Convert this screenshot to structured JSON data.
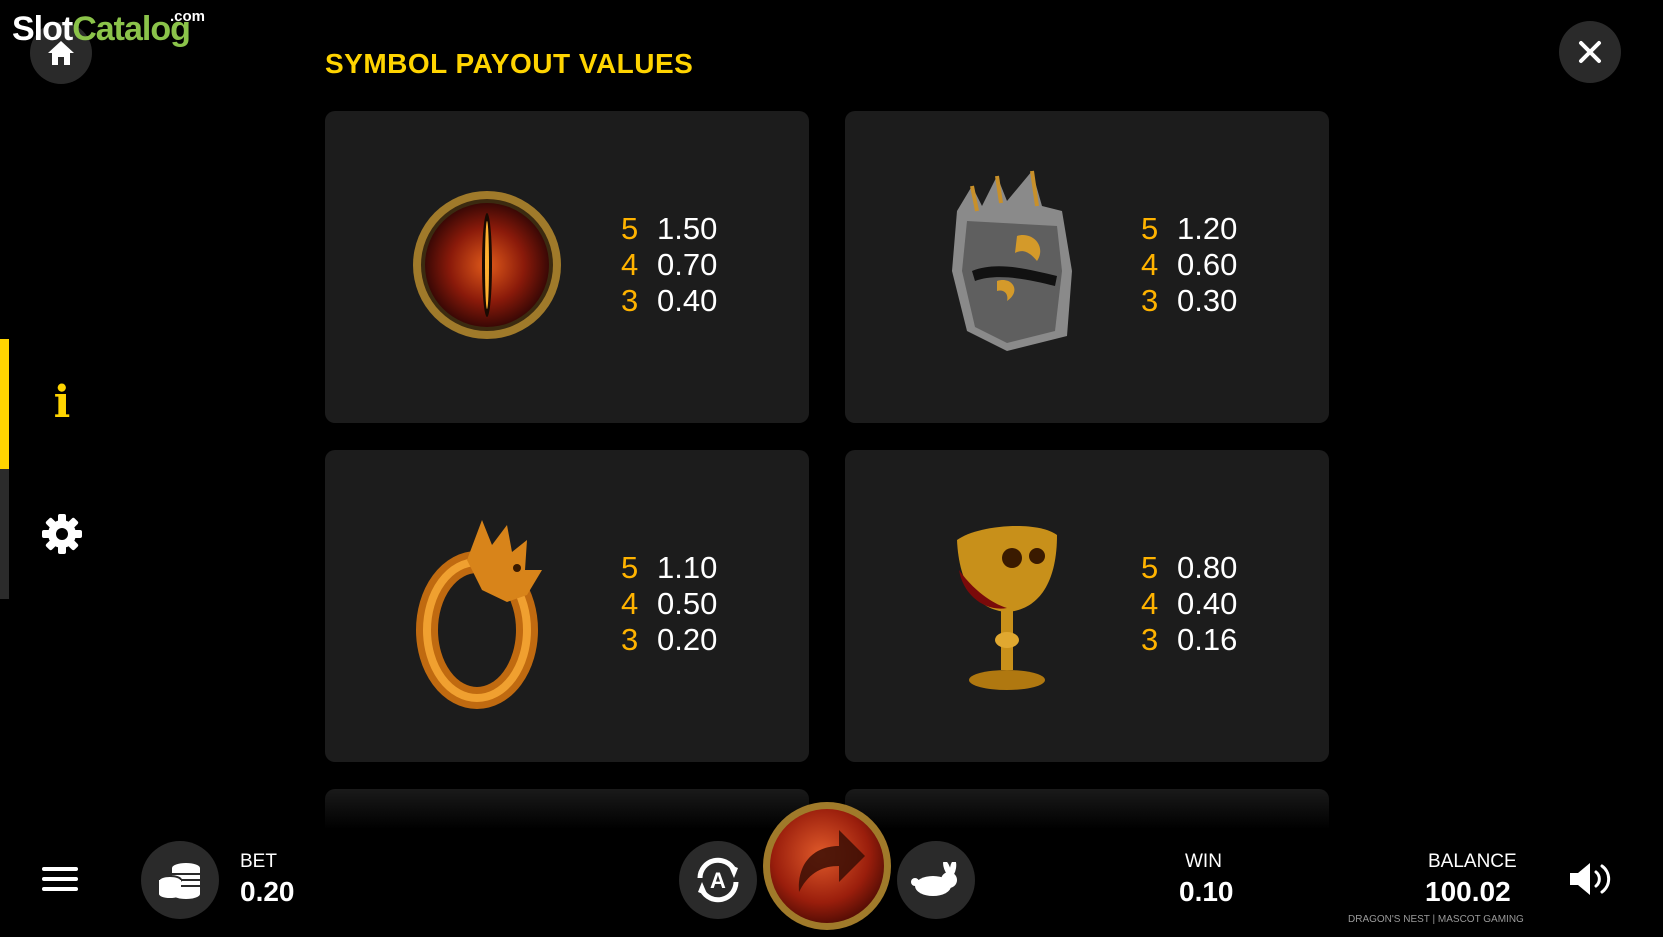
{
  "logo": {
    "part1": "Slot",
    "part2": "Catalog",
    "suffix": ".com"
  },
  "title": "SYMBOL PAYOUT VALUES",
  "symbols": [
    {
      "icon": "dragon-eye-icon",
      "pays": [
        {
          "count": "5",
          "value": "1.50"
        },
        {
          "count": "4",
          "value": "0.70"
        },
        {
          "count": "3",
          "value": "0.40"
        }
      ]
    },
    {
      "icon": "knight-helmet-icon",
      "pays": [
        {
          "count": "5",
          "value": "1.20"
        },
        {
          "count": "4",
          "value": "0.60"
        },
        {
          "count": "3",
          "value": "0.30"
        }
      ]
    },
    {
      "icon": "dragon-ring-icon",
      "pays": [
        {
          "count": "5",
          "value": "1.10"
        },
        {
          "count": "4",
          "value": "0.50"
        },
        {
          "count": "3",
          "value": "0.20"
        }
      ]
    },
    {
      "icon": "skull-goblet-icon",
      "pays": [
        {
          "count": "5",
          "value": "0.80"
        },
        {
          "count": "4",
          "value": "0.40"
        },
        {
          "count": "3",
          "value": "0.16"
        }
      ]
    }
  ],
  "side_nav": {
    "info_label": "i"
  },
  "bottom": {
    "bet_label": "BET",
    "bet_value": "0.20",
    "win_label": "WIN",
    "win_value": "0.10",
    "balance_label": "BALANCE",
    "balance_value": "100.02",
    "autoplay_letter": "A"
  },
  "credit": "DRAGON'S NEST | MASCOT GAMING",
  "colors": {
    "accent": "#ffd400",
    "count": "#ffb300",
    "card": "#1c1c1c"
  }
}
